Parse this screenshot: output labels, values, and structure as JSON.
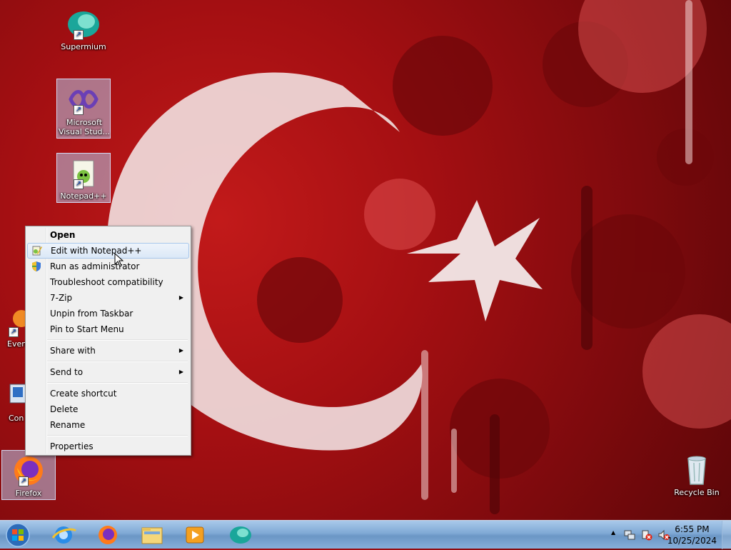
{
  "desktop": {
    "icons": [
      {
        "label": "Supermium"
      },
      {
        "label": "Microsoft Visual Stud..."
      },
      {
        "label": "Notepad++"
      },
      {
        "label": "Even"
      },
      {
        "label": "Con"
      },
      {
        "label": "Firefox"
      },
      {
        "label": "Recycle Bin"
      }
    ]
  },
  "context_menu": {
    "items": [
      {
        "label": "Open"
      },
      {
        "label": "Edit with Notepad++"
      },
      {
        "label": "Run as administrator"
      },
      {
        "label": "Troubleshoot compatibility"
      },
      {
        "label": "7-Zip"
      },
      {
        "label": "Unpin from Taskbar"
      },
      {
        "label": "Pin to Start Menu"
      },
      {
        "label": "Share with"
      },
      {
        "label": "Send to"
      },
      {
        "label": "Create shortcut"
      },
      {
        "label": "Delete"
      },
      {
        "label": "Rename"
      },
      {
        "label": "Properties"
      }
    ],
    "submenu_arrow": "▶"
  },
  "taskbar": {
    "clock": {
      "time": "6:55 PM",
      "date": "10/25/2024"
    },
    "tray_expand": "▲"
  },
  "colors": {
    "wallpaper_red": "#b3141a",
    "menu_bg": "#f0f0f0",
    "menu_hover": "#dbe8f7",
    "taskbar": "#7fa9d5"
  }
}
